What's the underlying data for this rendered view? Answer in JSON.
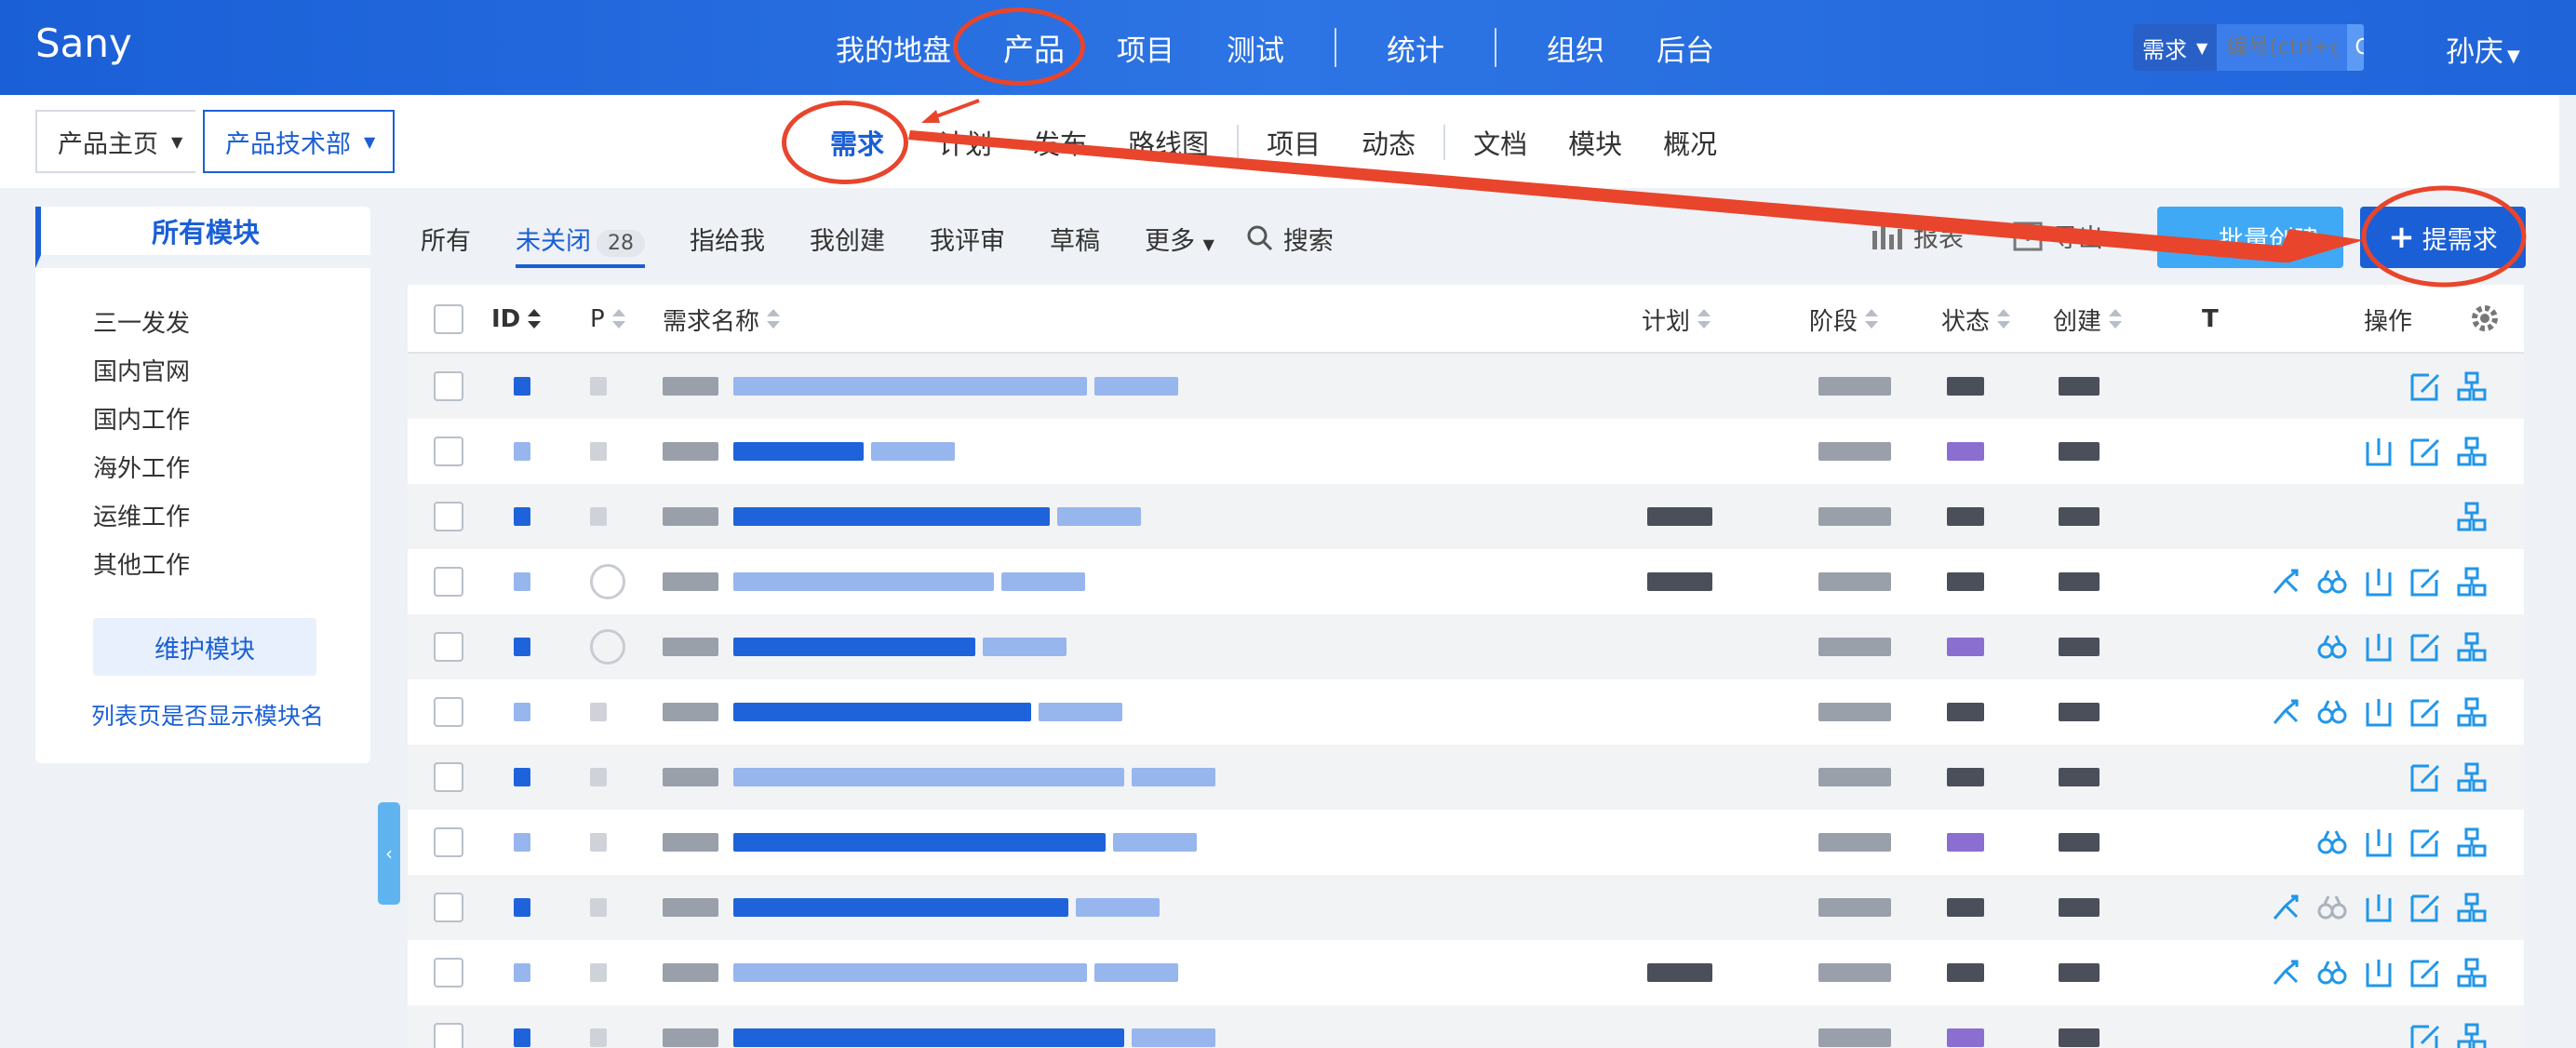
{
  "app": {
    "brand": "Sany"
  },
  "main_nav": {
    "items": [
      "我的地盘",
      "产品",
      "项目",
      "测试",
      "统计",
      "组织",
      "后台"
    ],
    "active": "产品"
  },
  "global_search": {
    "type_label": "需求",
    "placeholder": "编号(ctrl+g)",
    "go_label": "GO!"
  },
  "user": {
    "name": "孙庆"
  },
  "breadcrumb": {
    "home": "产品主页",
    "product": "产品技术部"
  },
  "sub_nav": {
    "items": [
      "需求",
      "计划",
      "发布",
      "路线图",
      "项目",
      "动态",
      "文档",
      "模块",
      "概况"
    ],
    "active": "需求"
  },
  "modules": {
    "header": "所有模块",
    "items": [
      "三一发发",
      "国内官网",
      "国内工作",
      "海外工作",
      "运维工作",
      "其他工作"
    ],
    "maintain_button": "维护模块",
    "show_module_link": "列表页是否显示模块名"
  },
  "filters": {
    "all": "所有",
    "unclosed": "未关闭",
    "unclosed_count": "28",
    "assigned_to_me": "指给我",
    "created_by_me": "我创建",
    "reviewed_by_me": "我评审",
    "draft": "草稿",
    "more": "更多",
    "search": "搜索"
  },
  "toolbar": {
    "report": "报表",
    "export": "导出",
    "batch_create": "批量创建",
    "add": "提需求"
  },
  "table": {
    "columns": {
      "id": "ID",
      "priority": "P",
      "title": "需求名称",
      "plan": "计划",
      "stage": "阶段",
      "status": "状态",
      "creator": "创建",
      "t": "T",
      "actions": "操作"
    }
  },
  "colors": {
    "primary": "#1a5fd6",
    "annotation_red": "#e8452c",
    "accent_light_blue": "#3fa9f5"
  },
  "icons": [
    "search-icon",
    "report-icon",
    "export-icon",
    "plus-icon",
    "gear-icon",
    "split-icon",
    "review-icon",
    "close-story-icon",
    "edit-icon",
    "create-case-icon",
    "collapse-icon"
  ]
}
